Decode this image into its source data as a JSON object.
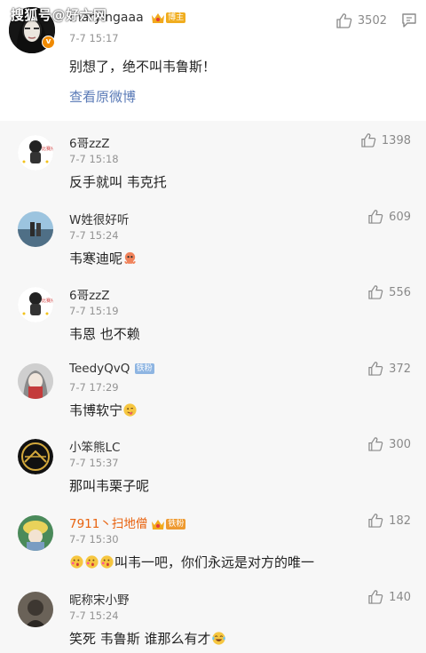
{
  "watermark": "搜狐号@好六网",
  "post": {
    "username": "maryingaaa",
    "badge": "博主",
    "time": "7-7 15:17",
    "text": "别想了，绝不叫韦鲁斯！",
    "view_original": "查看原微博",
    "likes": "3502"
  },
  "comments": [
    {
      "name": "6哥zzZ",
      "time": "7-7 15:18",
      "text": "反手就叫 韦克托",
      "likes": "1398"
    },
    {
      "name": "W姓很好听",
      "time": "7-7 15:24",
      "text": "韦寒迪呢",
      "likes": "609"
    },
    {
      "name": "6哥zzZ",
      "time": "7-7 15:19",
      "text": "韦恩 也不赖",
      "likes": "556"
    },
    {
      "name": "TeedyQvQ",
      "badge": "铁粉",
      "time": "7-7 17:29",
      "text": "韦博软宁",
      "likes": "372"
    },
    {
      "name": "小笨熊LC",
      "time": "7-7 15:37",
      "text": "那叫韦栗子呢",
      "likes": "300"
    },
    {
      "name": "7911丶扫地僧",
      "badge": "铁粉",
      "time": "7-7 15:30",
      "text": "叫韦一吧，你们永远是对方的唯一",
      "likes": "182"
    },
    {
      "name": "昵称宋小野",
      "time": "7-7 15:24",
      "text": "笑死 韦鲁斯 谁那么有才",
      "likes": "140"
    }
  ],
  "colors": {
    "link": "#5b7bb7",
    "reply_bg": "#f7f7f7",
    "orange_name": "#e8620e",
    "fan_badge": "#8eb5e2"
  }
}
